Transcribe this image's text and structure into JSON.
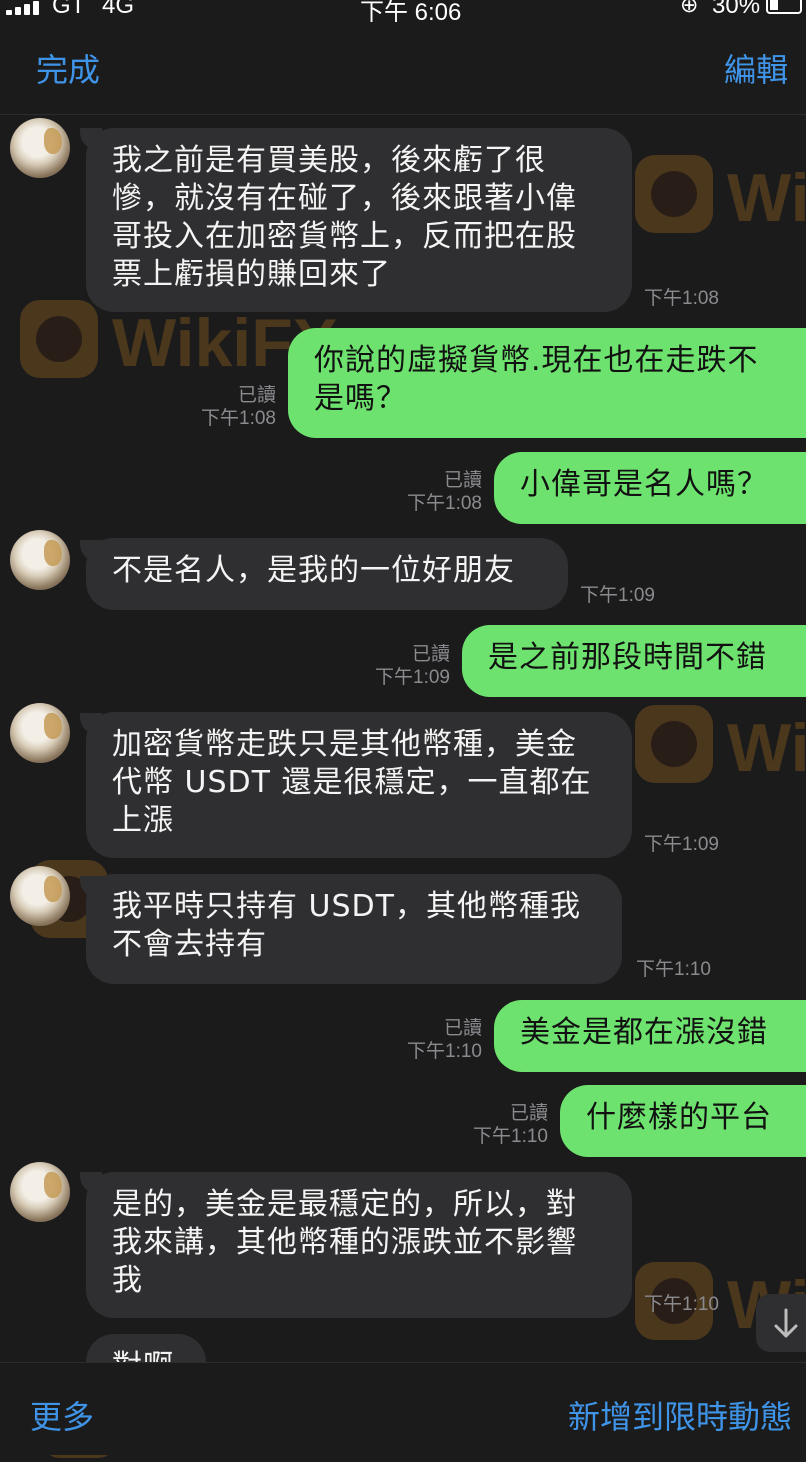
{
  "status_bar": {
    "carrier": "GT",
    "network": "4G",
    "time": "下午 6:06",
    "battery": "30%",
    "battery_level": 0.3
  },
  "nav": {
    "done_label": "完成",
    "edit_label": "編輯"
  },
  "messages": [
    {
      "side": "in",
      "lines": [
        "我之前是有買美股，後來虧了很",
        "慘，就沒有在碰了，後來跟著小偉",
        "哥投入在加密貨幣上，反而把在股",
        "票上虧損的賺回來了"
      ],
      "time": "下午1:08"
    },
    {
      "side": "out",
      "lines": [
        "你說的虛擬貨幣.現在也在走跌不",
        "是嗎？"
      ],
      "read": "已讀",
      "time": "下午1:08"
    },
    {
      "side": "out",
      "lines": [
        "小偉哥是名人嗎？"
      ],
      "read": "已讀",
      "time": "下午1:08"
    },
    {
      "side": "in",
      "lines": [
        "不是名人，是我的一位好朋友"
      ],
      "time": "下午1:09"
    },
    {
      "side": "out",
      "lines": [
        "是之前那段時間不錯"
      ],
      "read": "已讀",
      "time": "下午1:09"
    },
    {
      "side": "in",
      "lines": [
        "加密貨幣走跌只是其他幣種，美金",
        "代幣 USDT 還是很穩定，一直都在",
        "上漲"
      ],
      "time": "下午1:09"
    },
    {
      "side": "in",
      "lines": [
        "我平時只持有 USDT，其他幣種我",
        "不會去持有"
      ],
      "time": "下午1:10"
    },
    {
      "side": "out",
      "lines": [
        "美金是都在漲沒錯"
      ],
      "read": "已讀",
      "time": "下午1:10"
    },
    {
      "side": "out",
      "lines": [
        "什麼樣的平台"
      ],
      "read": "已讀",
      "time": "下午1:10"
    },
    {
      "side": "in",
      "lines": [
        "是的，美金是最穩定的，所以，對",
        "我來講，其他幣種的漲跌並不影響",
        "我"
      ],
      "time": "下午1:10"
    },
    {
      "side": "in",
      "lines": [
        "對啊"
      ],
      "time": ""
    }
  ],
  "watermark": {
    "text": "WikiFX",
    "color": "#f29a1e"
  },
  "icons": {
    "scroll_down": "arrow-down-icon",
    "avatar": "contact-avatar"
  },
  "colors": {
    "accent": "#3f94e8",
    "outgoing_bubble": "#6ee26e",
    "incoming_bubble": "#2f2f31",
    "background": "#1b1b1c"
  },
  "bottom_bar": {
    "more_label": "更多",
    "story_label": "新增到限時動態"
  }
}
